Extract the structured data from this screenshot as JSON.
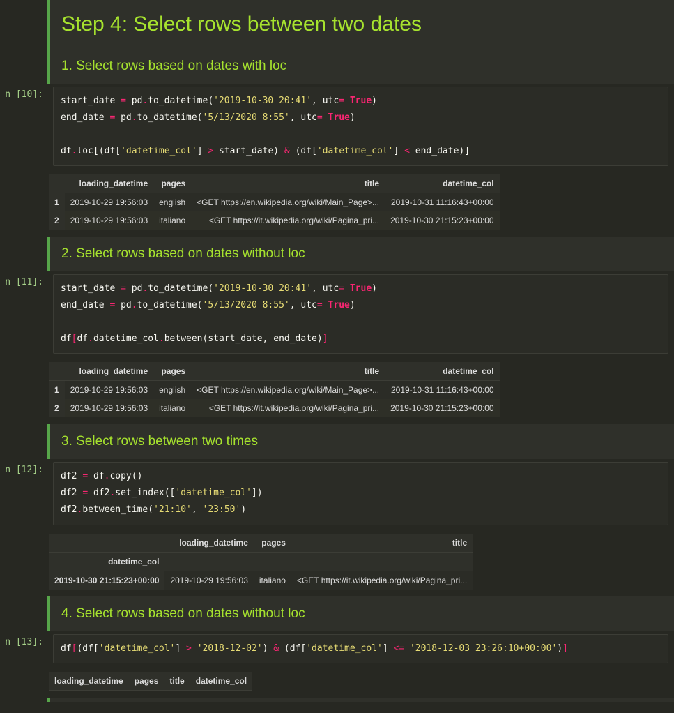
{
  "main_heading": "Step 4: Select rows between two dates",
  "sections": {
    "s1": {
      "title": "1. Select rows based on dates with loc"
    },
    "s2": {
      "title": "2. Select rows based on dates without loc"
    },
    "s3": {
      "title": "3. Select rows between two times"
    },
    "s4": {
      "title": "4. Select rows based on dates without loc"
    }
  },
  "prompts": {
    "in10": "n [10]:",
    "in11": "n [11]:",
    "in12": "n [12]:",
    "in13": "n [13]:"
  },
  "code": {
    "c10": {
      "l1_a": "start_date ",
      "l1_eq": "=",
      "l1_b": " pd",
      "l1_dot": ".",
      "l1_c": "to_datetime(",
      "l1_str": "'2019-10-30 20:41'",
      "l1_d": ", utc",
      "l1_eq2": "=",
      "l1_sp": " ",
      "l1_true": "True",
      "l1_e": ")",
      "l2_a": "end_date ",
      "l2_eq": "=",
      "l2_b": " pd",
      "l2_dot": ".",
      "l2_c": "to_datetime(",
      "l2_str": "'5/13/2020 8:55'",
      "l2_d": ", utc",
      "l2_eq2": "=",
      "l2_sp": " ",
      "l2_true": "True",
      "l2_e": ")",
      "l4_a": "df",
      "l4_dot": ".",
      "l4_b": "loc[(df[",
      "l4_str1": "'datetime_col'",
      "l4_c": "] ",
      "l4_gt": ">",
      "l4_d": " start_date) ",
      "l4_amp": "&",
      "l4_e": " (df[",
      "l4_str2": "'datetime_col'",
      "l4_f": "] ",
      "l4_lt": "<",
      "l4_g": " end_date)]"
    },
    "c11": {
      "l1_a": "start_date ",
      "l1_eq": "=",
      "l1_b": " pd",
      "l1_dot": ".",
      "l1_c": "to_datetime(",
      "l1_str": "'2019-10-30 20:41'",
      "l1_d": ", utc",
      "l1_eq2": "=",
      "l1_sp": " ",
      "l1_true": "True",
      "l1_e": ")",
      "l2_a": "end_date ",
      "l2_eq": "=",
      "l2_b": " pd",
      "l2_dot": ".",
      "l2_c": "to_datetime(",
      "l2_str": "'5/13/2020 8:55'",
      "l2_d": ", utc",
      "l2_eq2": "=",
      "l2_sp": " ",
      "l2_true": "True",
      "l2_e": ")",
      "l4_a": "df",
      "l4_blo": "[",
      "l4_b": "df",
      "l4_dot": ".",
      "l4_c": "datetime_col",
      "l4_dot2": ".",
      "l4_d": "between(start_date, end_date)",
      "l4_brc": "]"
    },
    "c12": {
      "l1_a": "df2 ",
      "l1_eq": "=",
      "l1_b": " df",
      "l1_dot": ".",
      "l1_c": "copy()",
      "l2_a": "df2 ",
      "l2_eq": "=",
      "l2_b": " df2",
      "l2_dot": ".",
      "l2_c": "set_index([",
      "l2_str": "'datetime_col'",
      "l2_d": "])",
      "l3_a": "df2",
      "l3_dot": ".",
      "l3_b": "between_time(",
      "l3_str1": "'21:10'",
      "l3_c": ", ",
      "l3_str2": "'23:50'",
      "l3_d": ")"
    },
    "c13": {
      "l1_a": "df",
      "l1_blo": "[",
      "l1_b": "(df[",
      "l1_str1": "'datetime_col'",
      "l1_c": "] ",
      "l1_gt": ">",
      "l1_d": " ",
      "l1_str2": "'2018-12-02'",
      "l1_e": ") ",
      "l1_amp": "&",
      "l1_f": " (df[",
      "l1_str3": "'datetime_col'",
      "l1_g": "] ",
      "l1_le": "<=",
      "l1_h": " ",
      "l1_str4": "'2018-12-03 23:26:10+00:00'",
      "l1_i": ")",
      "l1_brc": "]"
    }
  },
  "tables": {
    "t10": {
      "headers": [
        "",
        "loading_datetime",
        "pages",
        "title",
        "datetime_col"
      ],
      "rows": [
        [
          "1",
          "2019-10-29 19:56:03",
          "english",
          "<GET https://en.wikipedia.org/wiki/Main_Page>...",
          "2019-10-31 11:16:43+00:00"
        ],
        [
          "2",
          "2019-10-29 19:56:03",
          "italiano",
          "<GET https://it.wikipedia.org/wiki/Pagina_pri...",
          "2019-10-30 21:15:23+00:00"
        ]
      ]
    },
    "t11": {
      "headers": [
        "",
        "loading_datetime",
        "pages",
        "title",
        "datetime_col"
      ],
      "rows": [
        [
          "1",
          "2019-10-29 19:56:03",
          "english",
          "<GET https://en.wikipedia.org/wiki/Main_Page>...",
          "2019-10-31 11:16:43+00:00"
        ],
        [
          "2",
          "2019-10-29 19:56:03",
          "italiano",
          "<GET https://it.wikipedia.org/wiki/Pagina_pri...",
          "2019-10-30 21:15:23+00:00"
        ]
      ]
    },
    "t12": {
      "headers_top": [
        "",
        "loading_datetime",
        "pages",
        "title"
      ],
      "index_name": "datetime_col",
      "rows": [
        [
          "2019-10-30 21:15:23+00:00",
          "2019-10-29 19:56:03",
          "italiano",
          "<GET https://it.wikipedia.org/wiki/Pagina_pri..."
        ]
      ]
    },
    "t13": {
      "headers": [
        "loading_datetime",
        "pages",
        "title",
        "datetime_col"
      ]
    }
  }
}
